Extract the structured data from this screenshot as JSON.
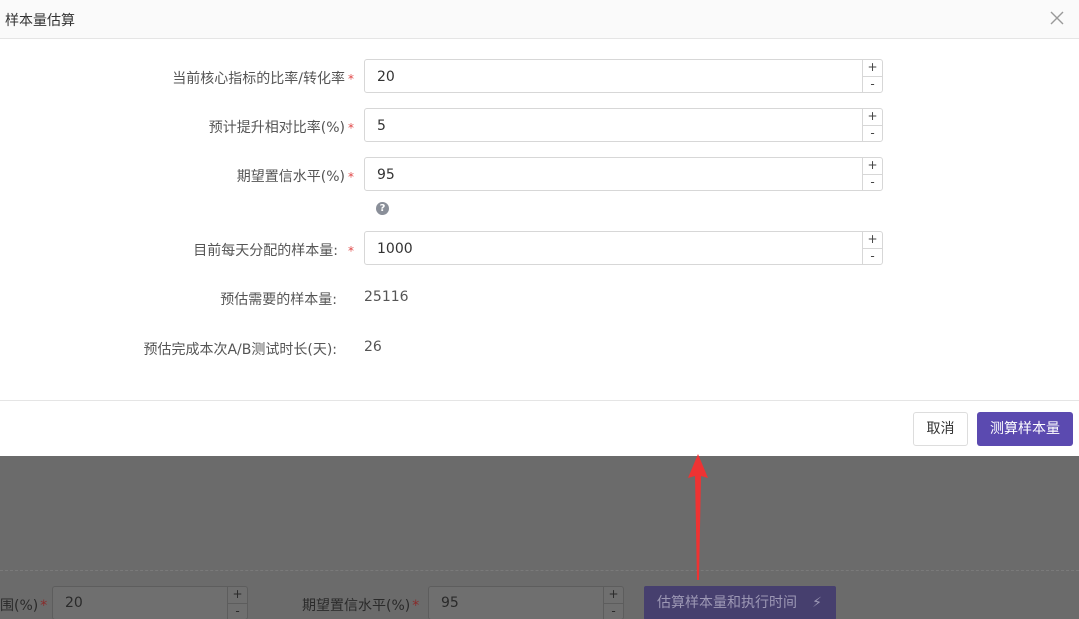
{
  "modal": {
    "title": "样本量估算",
    "fields": [
      {
        "label": "当前核心指标的比率/转化率",
        "required_mark": "*",
        "value": "20",
        "inc": "+",
        "dec": "-"
      },
      {
        "label": "预计提升相对比率(%)",
        "required_mark": "*",
        "value": "5",
        "inc": "+",
        "dec": "-"
      },
      {
        "label": "期望置信水平(%)",
        "required_mark": "*",
        "value": "95",
        "inc": "+",
        "dec": "-"
      },
      {
        "label": "目前每天分配的样本量:",
        "required_mark": "*",
        "value": "1000",
        "inc": "+",
        "dec": "-"
      }
    ],
    "help_icon": "question-circle-icon",
    "help_glyph": "?",
    "results": [
      {
        "label": "预估需要的样本量:",
        "value": "25116"
      },
      {
        "label": "预估完成本次A/B测试时长(天):",
        "value": "26"
      }
    ],
    "cancel_label": "取消",
    "submit_label": "测算样本量",
    "accent_color": "#5b4ab0"
  },
  "background": {
    "field1_label": "围(%)",
    "field1_required": "*",
    "field1_value": "20",
    "field2_label": "期望置信水平(%)",
    "field2_required": "*",
    "field2_value": "95",
    "stepper_inc": "+",
    "stepper_dec": "-",
    "button_label": "估算样本量和执行时间",
    "button_icon": "lightning-icon",
    "button_glyph": "⚡"
  },
  "annotation": {
    "arrow_color": "#ee3333"
  }
}
